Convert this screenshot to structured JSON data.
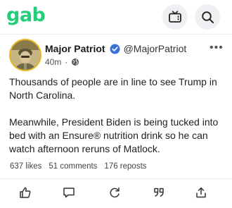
{
  "header": {
    "logo_text": "gab",
    "logo_color": "#21cf7a",
    "icons": [
      "tv-icon",
      "search-icon"
    ]
  },
  "post": {
    "author": {
      "display_name": "Major Patriot",
      "handle": "@MajorPatriot",
      "verified": true,
      "verified_color": "#3d6fd9"
    },
    "time": "40m",
    "visibility_icon": "globe-icon",
    "body": [
      "Thousands of people are in line to see Trump in North Carolina.",
      "Meanwhile, President Biden is being tucked into bed with an Ensure® nutrition drink so he can watch afternoon reruns of Matlock."
    ],
    "stats": {
      "likes": "637 likes",
      "comments": "51 comments",
      "reposts": "176 reposts"
    },
    "actions": [
      "like-icon",
      "comment-icon",
      "repost-icon",
      "quote-icon",
      "share-icon"
    ]
  }
}
